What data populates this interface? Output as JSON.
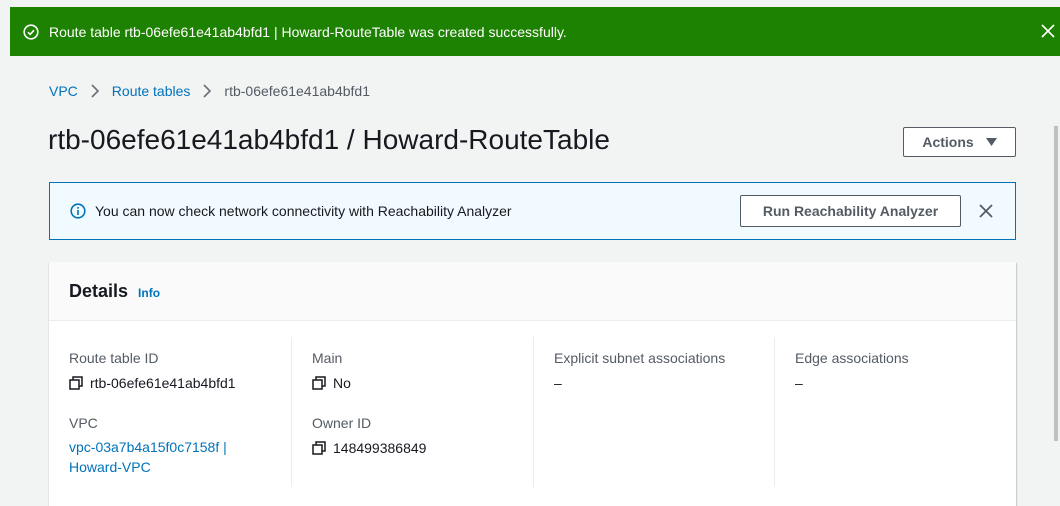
{
  "flash": {
    "message": "Route table rtb-06efe61e41ab4bfd1 | Howard-RouteTable was created successfully.",
    "icon": "success-check-icon",
    "color": "#1d8102"
  },
  "breadcrumb": {
    "items": [
      "VPC",
      "Route tables"
    ],
    "current": "rtb-06efe61e41ab4bfd1"
  },
  "page": {
    "title": "rtb-06efe61e41ab4bfd1 / Howard-RouteTable",
    "actions_label": "Actions"
  },
  "alert": {
    "text": "You can now check network connectivity with Reachability Analyzer",
    "button_label": "Run Reachability Analyzer"
  },
  "details": {
    "title": "Details",
    "info_label": "Info",
    "route_table_id_label": "Route table ID",
    "route_table_id": "rtb-06efe61e41ab4bfd1",
    "vpc_label": "VPC",
    "vpc_line1": "vpc-03a7b4a15f0c7158f |",
    "vpc_line2": "Howard-VPC",
    "main_label": "Main",
    "main_value": "No",
    "owner_label": "Owner ID",
    "owner_value": "148499386849",
    "explicit_label": "Explicit subnet associations",
    "explicit_value": "–",
    "edge_label": "Edge associations",
    "edge_value": "–"
  }
}
